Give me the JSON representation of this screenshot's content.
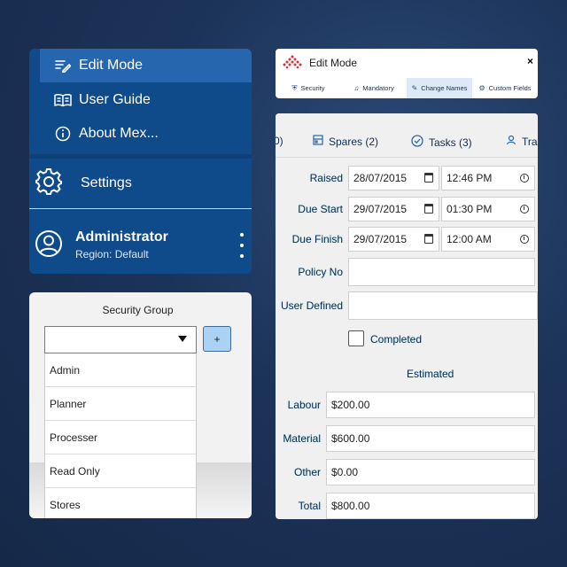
{
  "menu": {
    "items": [
      {
        "label": "Edit Mode",
        "icon": "edit-list-icon",
        "active": true
      },
      {
        "label": "User Guide",
        "icon": "book-icon",
        "active": false
      },
      {
        "label": "About Mex...",
        "icon": "info-icon",
        "active": false
      }
    ],
    "settings_label": "Settings",
    "user": {
      "name": "Administrator",
      "region": "Region: Default"
    }
  },
  "security": {
    "title": "Security Group",
    "add_label": "+",
    "options": [
      "Admin",
      "Planner",
      "Processer",
      "Read Only",
      "Stores"
    ]
  },
  "edit_mode": {
    "title": "Edit Mode",
    "close_label": "×",
    "tabs": [
      {
        "label": "Security",
        "icon": "shield-icon"
      },
      {
        "label": "Mandatory",
        "icon": "bell-icon"
      },
      {
        "label": "Change Names",
        "icon": "rename-icon",
        "active": true
      },
      {
        "label": "Custom Fields",
        "icon": "fields-icon"
      }
    ]
  },
  "form": {
    "tabs": {
      "prev_fragment": "0)",
      "spares": "Spares (2)",
      "tasks": "Tasks (3)",
      "next_fragment": "Tra"
    },
    "raised": {
      "label": "Raised",
      "date": "28/07/2015",
      "time": "12:46 PM"
    },
    "due_start": {
      "label": "Due Start",
      "date": "29/07/2015",
      "time": "01:30 PM"
    },
    "due_finish": {
      "label": "Due Finish",
      "date": "29/07/2015",
      "time": "12:00 AM"
    },
    "policy_no": {
      "label": "Policy No",
      "value": ""
    },
    "user_defined": {
      "label": "User Defined",
      "value": ""
    },
    "completed_label": "Completed",
    "estimated_title": "Estimated",
    "labour": {
      "label": "Labour",
      "value": "$200.00"
    },
    "material": {
      "label": "Material",
      "value": "$600.00"
    },
    "other": {
      "label": "Other",
      "value": "$0.00"
    },
    "total": {
      "label": "Total",
      "value": "$800.00"
    }
  }
}
